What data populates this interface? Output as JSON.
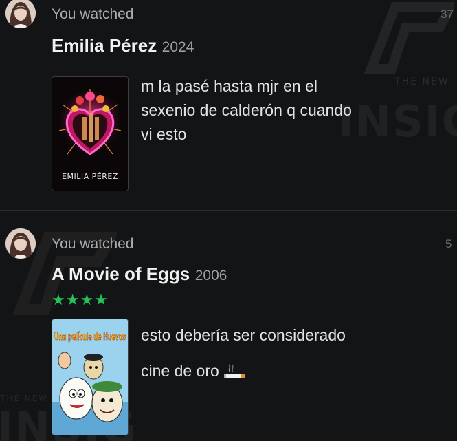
{
  "feed": {
    "entries": [
      {
        "activity_label": "You watched",
        "time_ago": "37",
        "movie_title": "Emilia Pérez",
        "year": "2024",
        "rating_stars": "",
        "poster_title": "EMILIA PÉREZ",
        "review_lines": [
          "m la pasé hasta mjr en el",
          "sexenio de calderón q cuando",
          "vi esto"
        ]
      },
      {
        "activity_label": "You watched",
        "time_ago": "5",
        "movie_title": "A Movie of Eggs",
        "year": "2006",
        "rating_stars": "★★★★",
        "rating_value": 4,
        "poster_title": "Una película de Huevos",
        "review_lines": [
          "esto debería ser considerado",
          "cine de oro"
        ]
      }
    ]
  },
  "watermark": {
    "brand_text": "INSIG",
    "brand_sub": "THE NEW"
  },
  "colors": {
    "background": "#131415",
    "star_green": "#25c15a",
    "muted_text": "#a9abac"
  }
}
